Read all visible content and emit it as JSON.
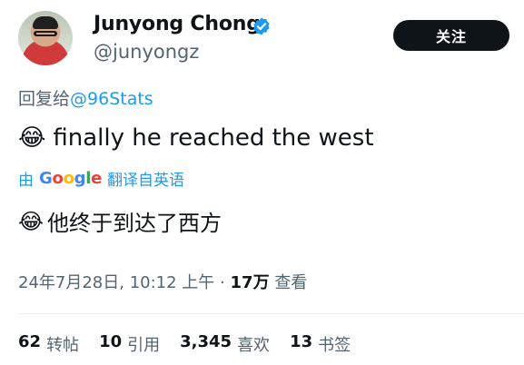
{
  "author": {
    "display_name": "Junyong Chong",
    "handle": "@junyongz",
    "verified_icon": "verified-badge-icon",
    "avatar_icon": "profile-photo"
  },
  "follow_button": {
    "label": "关注"
  },
  "reply": {
    "prefix": "回复给",
    "mention": "@96Stats"
  },
  "tweet": {
    "emoji": "😂",
    "text": "finally he reached the west"
  },
  "translation": {
    "prefix": "由",
    "provider": "Google",
    "suffix": "翻译自英语",
    "emoji": "😂",
    "text": "他终于到达了西方"
  },
  "meta": {
    "timestamp": "24年7月28日, 10:12 上午",
    "separator": "·",
    "views_count": "17万",
    "views_label": "查看"
  },
  "stats": [
    {
      "count": "62",
      "label": "转帖"
    },
    {
      "count": "10",
      "label": "引用"
    },
    {
      "count": "3,345",
      "label": "喜欢"
    },
    {
      "count": "13",
      "label": "书签"
    }
  ],
  "colors": {
    "accent": "#1d9bf0",
    "text_primary": "#0f1419",
    "text_secondary": "#536471",
    "button_bg": "#0f1419"
  }
}
